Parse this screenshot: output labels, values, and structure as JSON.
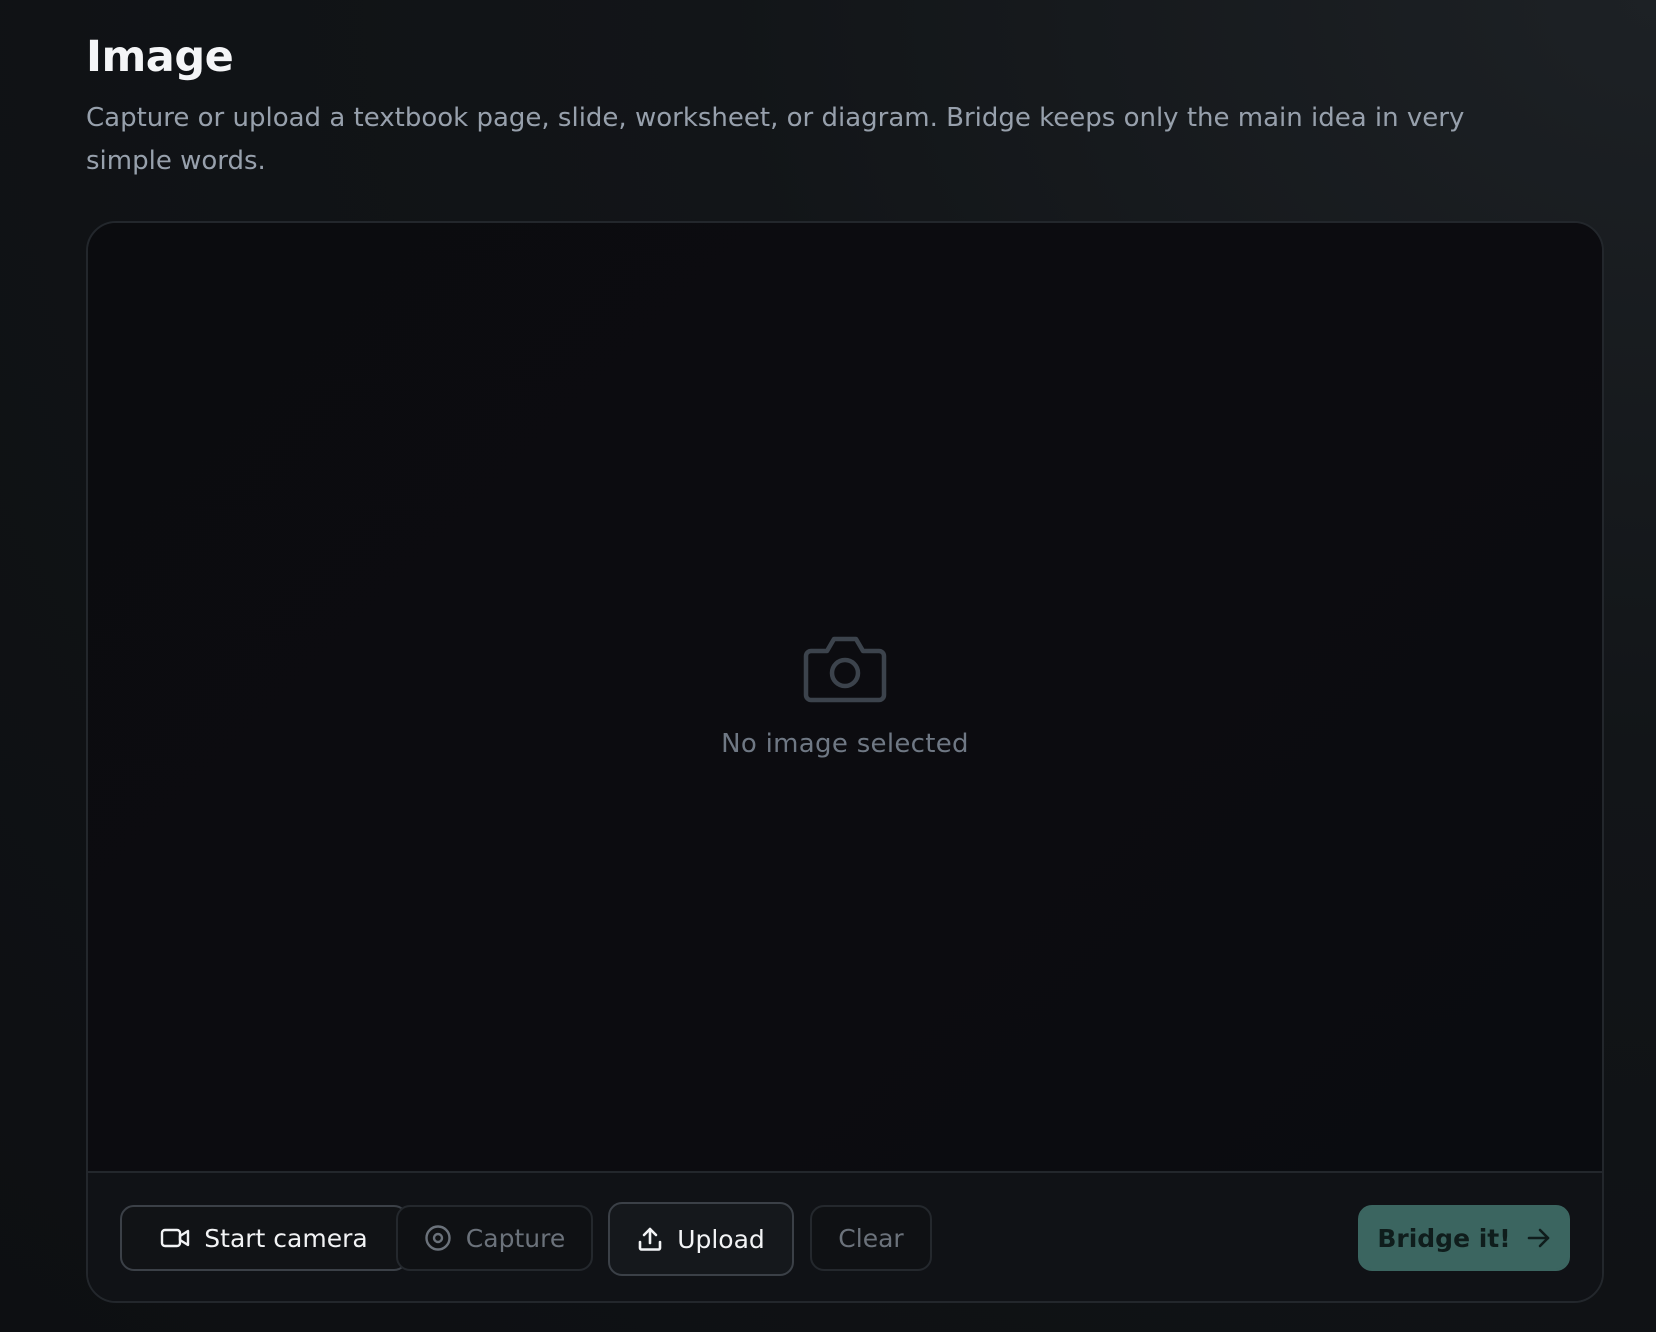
{
  "section": {
    "title": "Image",
    "description": "Capture or upload a textbook page, slide, worksheet, or diagram. Bridge keeps only the main idea in very simple words."
  },
  "preview": {
    "empty_icon": "camera-icon",
    "empty_text": "No image selected"
  },
  "toolbar": {
    "start_camera": {
      "label": "Start camera",
      "icon": "video-camera-icon",
      "enabled": true
    },
    "capture": {
      "label": "Capture",
      "icon": "shutter-icon",
      "enabled": false
    },
    "upload": {
      "label": "Upload",
      "icon": "upload-icon",
      "enabled": true
    },
    "clear": {
      "label": "Clear",
      "enabled": false
    },
    "bridge": {
      "label": "Bridge it!",
      "icon": "arrow-right-icon",
      "enabled": true
    }
  },
  "colors": {
    "accent": "#3b6560",
    "text_primary": "#f4f5f7",
    "text_secondary": "#97a0ac",
    "text_muted": "#6f7884",
    "border": "#23272c"
  }
}
